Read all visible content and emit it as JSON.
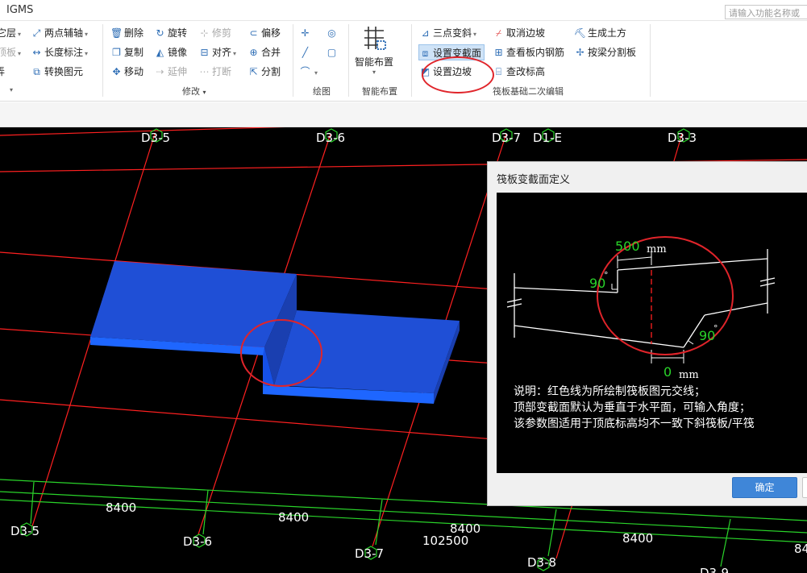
{
  "app": {
    "title": "IGMS",
    "search_placeholder": "请输入功能名称或"
  },
  "ribbon": {
    "col0": {
      "r1": "它层",
      "r2": "顶板",
      "r3": "弄"
    },
    "col1": {
      "r1": "两点辅轴",
      "r2": "长度标注",
      "r3": "转换图元"
    },
    "modify": {
      "delete": "删除",
      "rotate": "旋转",
      "trim": "修剪",
      "offset": "偏移",
      "copy": "复制",
      "mirror": "镜像",
      "align": "对齐",
      "merge": "合并",
      "move": "移动",
      "extend": "延伸",
      "break": "打断",
      "split": "分割"
    },
    "smart_layout": "智能布置",
    "raft": {
      "three_point_slope": "三点变斜",
      "cancel_edge_slope": "取消边坡",
      "generate_earthwork": "生成土方",
      "set_variable_section": "设置变截面",
      "view_rebar": "查看板内钢筋",
      "split_by_beam": "按梁分割板",
      "set_edge_slope": "设置边坡",
      "view_elevation": "查改标高"
    },
    "groups": {
      "modify": "修改",
      "draw": "绘图",
      "smart_layout": "智能布置",
      "raft_edit": "筏板基础二次编辑"
    },
    "colors": {
      "accent": "#2d6db5",
      "highlight": "#cfe3f7",
      "annotation": "#e0242a"
    }
  },
  "canvas": {
    "axis_labels_top": [
      "D3-5",
      "D3-6",
      "D3-7",
      "D1-E",
      "D3-3"
    ],
    "axis_labels_bottom": [
      "D3-5",
      "D3-6",
      "D3-7",
      "D3-8",
      "D3-9"
    ],
    "dimensions": [
      "8400",
      "8400",
      "8400",
      "8400",
      "84"
    ],
    "total_dimension": "102500",
    "colors": {
      "grid": "#ff2020",
      "dim_line": "#2ad42a",
      "slab_top": "#1f4fd6",
      "slab_side": "#1a3fb0",
      "slab_front": "#1e66ff"
    }
  },
  "dialog": {
    "title": "筏板变截面定义",
    "diagram": {
      "top_dim_value": "500",
      "bottom_dim_value": "0",
      "unit": "mm",
      "angle_left": "90",
      "angle_right": "90",
      "degree_mark": "°"
    },
    "notes": [
      "说明：红色线为所绘制筏板图元交线；",
      "顶部变截面默认为垂直于水平面，可输入角度；",
      "该参数图适用于顶底标高均不一致下斜筏板/平筏"
    ],
    "ok_label": "确定"
  }
}
